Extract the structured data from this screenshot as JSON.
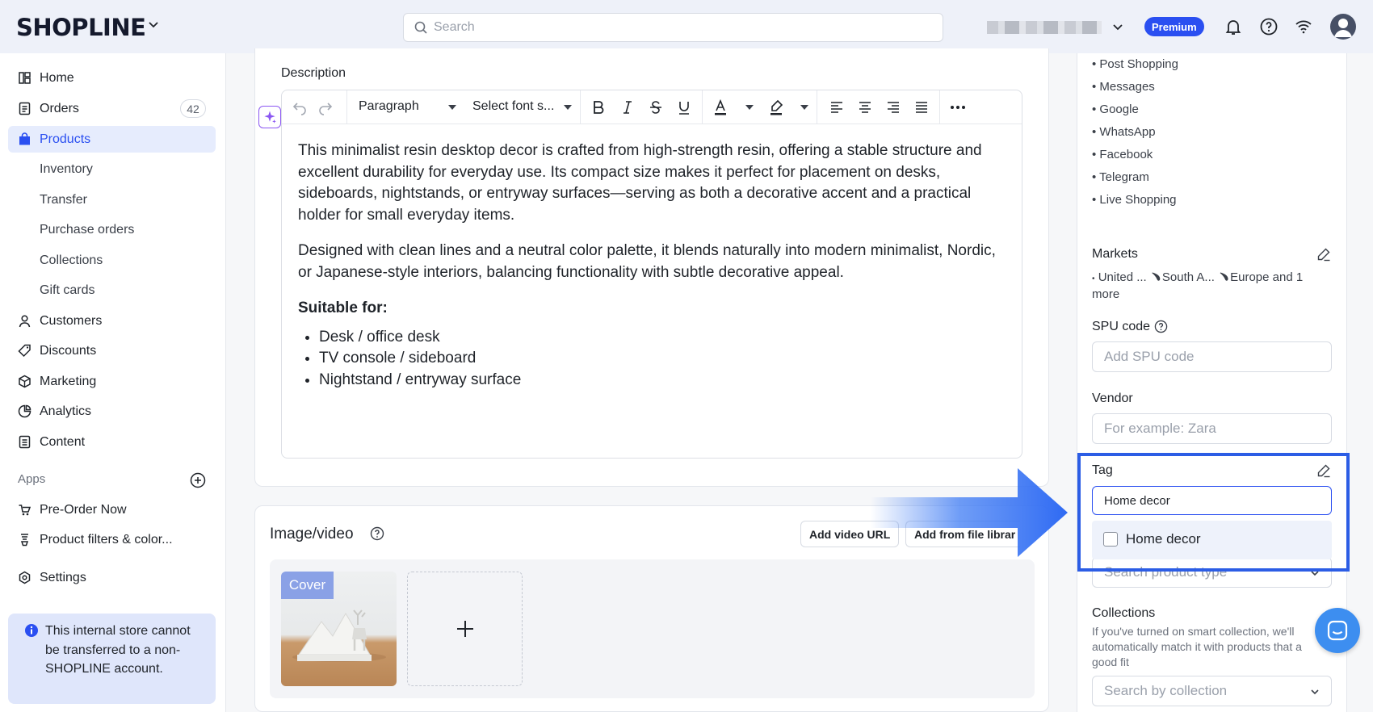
{
  "header": {
    "logo": "SHOPLINE",
    "search_placeholder": "Search",
    "premium_label": "Premium"
  },
  "sidebar": {
    "items": [
      {
        "label": "Home"
      },
      {
        "label": "Orders",
        "badge": "42"
      },
      {
        "label": "Products"
      },
      {
        "label": "Inventory"
      },
      {
        "label": "Transfer"
      },
      {
        "label": "Purchase orders"
      },
      {
        "label": "Collections"
      },
      {
        "label": "Gift cards"
      },
      {
        "label": "Customers"
      },
      {
        "label": "Discounts"
      },
      {
        "label": "Marketing"
      },
      {
        "label": "Analytics"
      },
      {
        "label": "Content"
      }
    ],
    "apps_heading": "Apps",
    "apps": [
      {
        "label": "Pre-Order Now"
      },
      {
        "label": "Product filters & color..."
      }
    ],
    "settings_label": "Settings",
    "notice": "This internal store cannot be transferred to a non-SHOPLINE account."
  },
  "description": {
    "label": "Description",
    "block_format": "Paragraph",
    "font_size": "Select font s...",
    "paragraph1": "This minimalist resin desktop decor is crafted from high-strength resin, offering a stable structure and excellent durability for everyday use. Its compact size makes it perfect for placement on desks, sideboards, nightstands, or entryway surfaces—serving as both a decorative accent and a practical holder for small everyday items.",
    "paragraph2": "Designed with clean lines and a neutral color palette, it blends naturally into modern minimalist, Nordic, or Japanese-style interiors, balancing functionality with subtle decorative appeal.",
    "suitable_heading": "Suitable for:",
    "suitable_items": [
      "Desk / office desk",
      "TV console / sideboard",
      "Nightstand / entryway surface"
    ]
  },
  "media": {
    "title": "Image/video",
    "add_video_url": "Add video URL",
    "add_from_library": "Add from file librar",
    "cover_label": "Cover"
  },
  "right_panel": {
    "channels": [
      "Post Shopping",
      "Messages",
      "Google",
      "WhatsApp",
      "Facebook",
      "Telegram",
      "Live Shopping"
    ],
    "markets_label": "Markets",
    "markets_value": "United ... ﹅South A... ﹅Europe and 1 more",
    "spu_label": "SPU code",
    "spu_placeholder": "Add SPU code",
    "vendor_label": "Vendor",
    "vendor_placeholder": "For example: Zara",
    "tag_label": "Tag",
    "tag_value": "Home decor",
    "tag_option": "Home decor",
    "product_type_placeholder": "Search product type",
    "collections_label": "Collections",
    "collections_help": "If you've turned on smart collection, we'll automatically match it with products that a good fit",
    "collections_placeholder": "Search by collection"
  },
  "colors": {
    "accent": "#2a4ff1",
    "highlight": "#2c5de5"
  }
}
